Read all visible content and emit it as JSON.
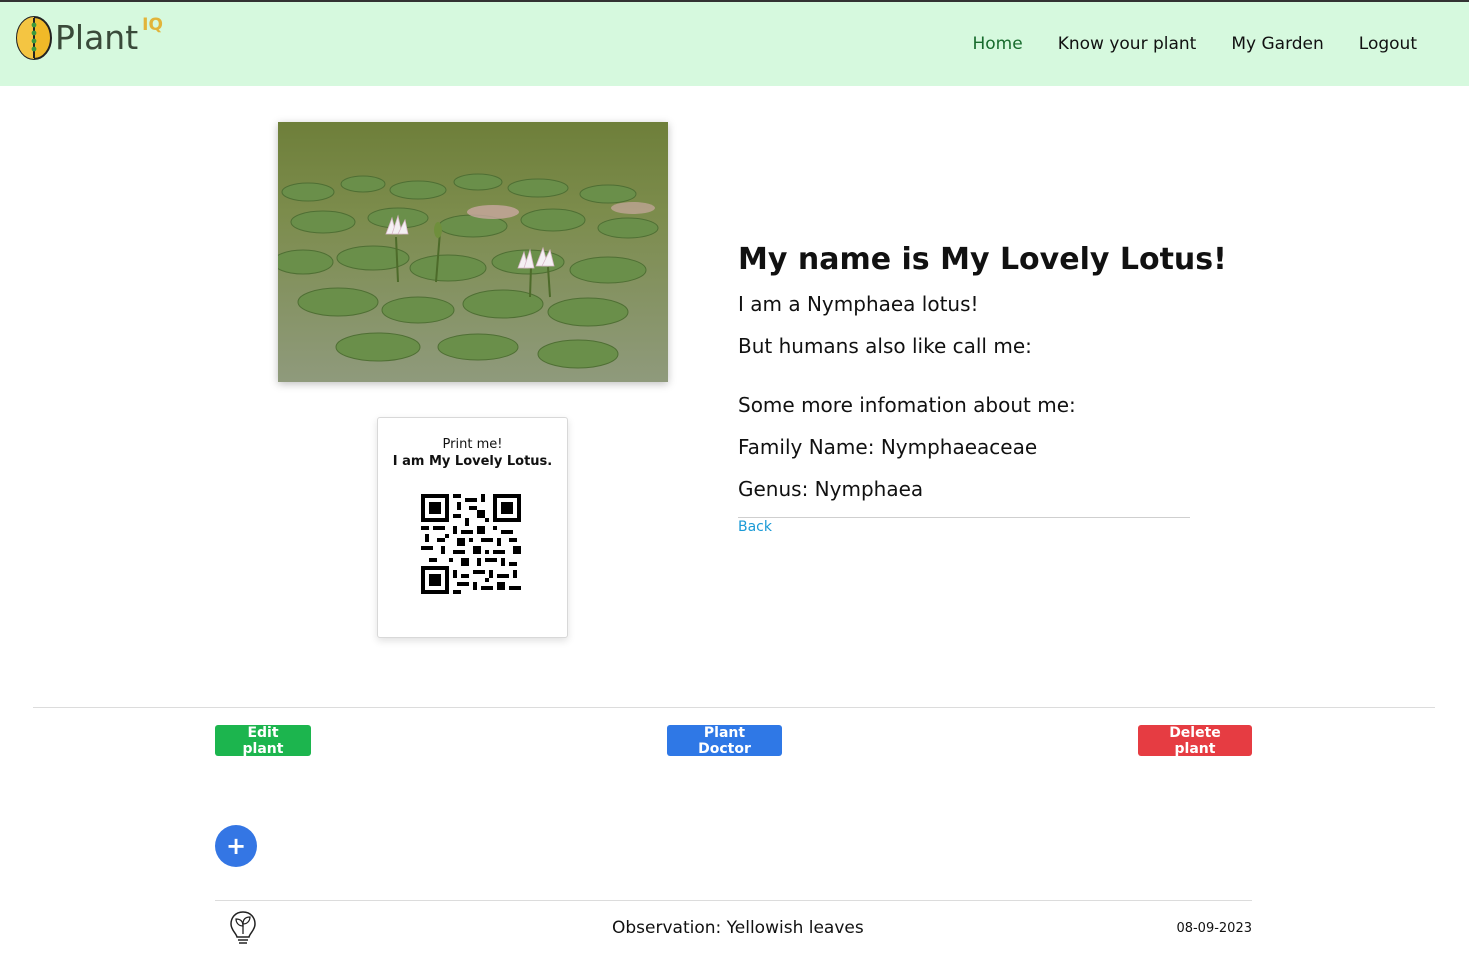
{
  "header": {
    "logo_text": "Plant",
    "logo_superscript": "IQ",
    "nav": [
      {
        "label": "Home",
        "active": true
      },
      {
        "label": "Know your plant",
        "active": false
      },
      {
        "label": "My Garden",
        "active": false
      },
      {
        "label": "Logout",
        "active": false
      }
    ]
  },
  "qr_card": {
    "print_label": "Print me!",
    "plant_label": "I am My Lovely Lotus."
  },
  "plant": {
    "title": "My name is My Lovely Lotus!",
    "species_line": "I am a Nymphaea lotus!",
    "common_names_line": "But humans also like call me:",
    "more_info_line": "Some more infomation about me:",
    "family_line": "Family Name: Nymphaeaceae",
    "genus_line": "Genus: Nymphaea",
    "back_label": "Back"
  },
  "actions": {
    "edit_label": "Edit plant",
    "doctor_label": "Plant Doctor",
    "delete_label": "Delete plant",
    "add_label": "+"
  },
  "observations": [
    {
      "text": "Observation: Yellowish leaves",
      "date": "08-09-2023",
      "icon": "sprout-bulb-icon"
    }
  ],
  "colors": {
    "header_bg": "#d6f9de",
    "edit": "#1cb54e",
    "doctor": "#2f78e6",
    "delete": "#e63c42",
    "link": "#1a9ad6"
  }
}
